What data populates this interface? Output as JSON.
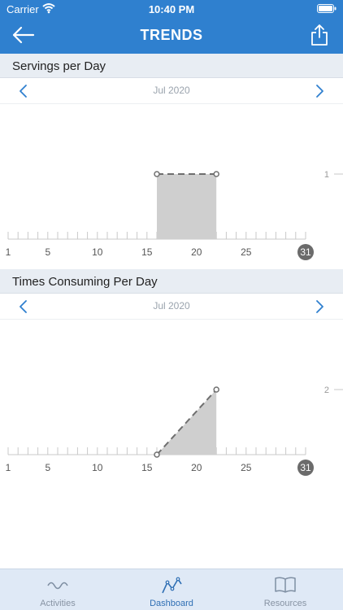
{
  "status_bar": {
    "carrier": "Carrier",
    "time": "10:40 PM"
  },
  "nav": {
    "title": "TRENDS"
  },
  "charts": [
    {
      "section_title": "Servings per Day",
      "month": "Jul 2020",
      "y_tick": "1",
      "x_tick_labels": [
        "1",
        "5",
        "10",
        "15",
        "20",
        "25",
        "31"
      ],
      "highlight_day": "31"
    },
    {
      "section_title": "Times Consuming Per Day",
      "month": "Jul 2020",
      "y_tick": "2",
      "x_tick_labels": [
        "1",
        "5",
        "10",
        "15",
        "20",
        "25",
        "31"
      ],
      "highlight_day": "31"
    }
  ],
  "chart_data": [
    {
      "type": "area",
      "title": "Servings per Day",
      "x_label_unit": "day of Jul 2020",
      "xlim": [
        1,
        31
      ],
      "points": [
        [
          16,
          1
        ],
        [
          22,
          1
        ]
      ],
      "y_ticks": [
        1
      ]
    },
    {
      "type": "area",
      "title": "Times Consuming Per Day",
      "x_label_unit": "day of Jul 2020",
      "xlim": [
        1,
        31
      ],
      "points": [
        [
          16,
          0
        ],
        [
          22,
          2
        ]
      ],
      "y_ticks": [
        2
      ]
    }
  ],
  "tabs": [
    {
      "label": "Activities",
      "icon": "wave-icon",
      "active": false
    },
    {
      "label": "Dashboard",
      "icon": "trend-line-icon",
      "active": true
    },
    {
      "label": "Resources",
      "icon": "book-icon",
      "active": false
    }
  ],
  "colors": {
    "brand": "#2f80cf",
    "area_fill": "#cfcfcf",
    "tab_active": "#2f6fb4"
  }
}
